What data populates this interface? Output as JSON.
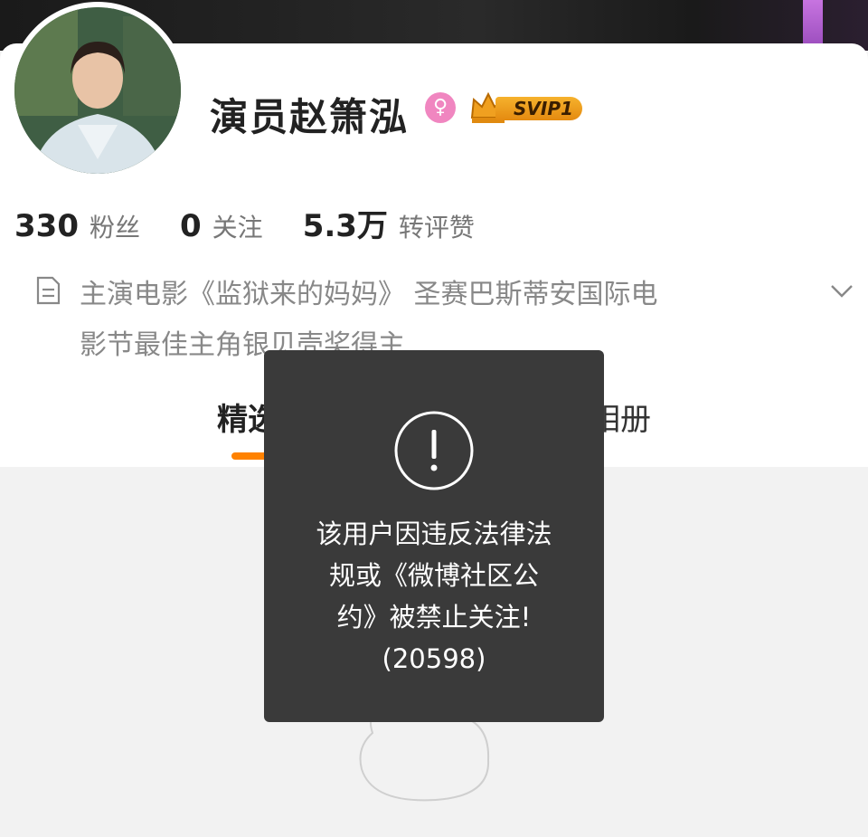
{
  "profile": {
    "name": "演员赵箫泓",
    "gender_icon": "female-icon",
    "vip_badge": "SVIP1"
  },
  "stats": [
    {
      "value": "330",
      "label": "粉丝"
    },
    {
      "value": "0",
      "label": "关注"
    },
    {
      "value": "5.3万",
      "label": "转评赞"
    }
  ],
  "bio": {
    "line1": "主演电影《监狱来的妈妈》 圣赛巴斯蒂安国际电",
    "line2": "影节最佳主角银贝壳奖得主"
  },
  "tabs": [
    {
      "label": "精选"
    },
    {
      "label": "相册"
    }
  ],
  "toast": {
    "icon": "exclamation-circle-icon",
    "message_line1": "该用户因违反法律法",
    "message_line2": "规或《微博社区公",
    "message_line3": "约》被禁止关注!",
    "code": "(20598)"
  },
  "colors": {
    "accent": "#ff8200",
    "toast_bg": "#3a3a3a",
    "svip": "#f0a020"
  }
}
